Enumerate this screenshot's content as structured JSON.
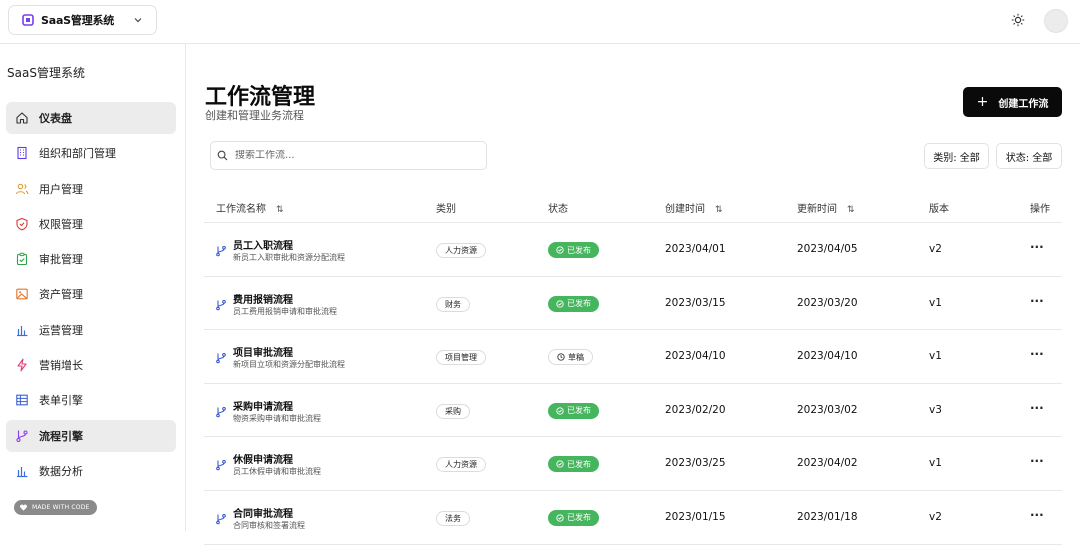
{
  "header": {
    "app_name": "SaaS管理系统",
    "theme_icon": "sun-icon",
    "avatar_icon": "user-avatar"
  },
  "sidebar": {
    "brand": "SaaS管理系统",
    "items": [
      {
        "label": "仪表盘",
        "icon": "home-icon",
        "active": true
      },
      {
        "label": "组织和部门管理",
        "icon": "building-icon"
      },
      {
        "label": "用户管理",
        "icon": "users-icon"
      },
      {
        "label": "权限管理",
        "icon": "shield-icon"
      },
      {
        "label": "审批管理",
        "icon": "clipboard-check-icon"
      },
      {
        "label": "资产管理",
        "icon": "image-icon"
      },
      {
        "label": "运营管理",
        "icon": "bar-chart-icon"
      },
      {
        "label": "营销增长",
        "icon": "zap-icon"
      },
      {
        "label": "表单引擎",
        "icon": "table-icon"
      },
      {
        "label": "流程引擎",
        "icon": "git-branch-icon",
        "active": true
      },
      {
        "label": "数据分析",
        "icon": "bar-chart-icon"
      }
    ],
    "badge": "MADE WITH CODE"
  },
  "main": {
    "title": "工作流管理",
    "subtitle": "创建和管理业务流程",
    "create_button": "创建工作流",
    "search_placeholder": "搜索工作流...",
    "filter_category": "类别: 全部",
    "filter_status": "状态: 全部",
    "columns": {
      "name": "工作流名称",
      "category": "类别",
      "status": "状态",
      "created": "创建时间",
      "updated": "更新时间",
      "version": "版本",
      "actions": "操作"
    },
    "rows": [
      {
        "name": "员工入职流程",
        "desc": "新员工入职审批和资源分配流程",
        "category": "人力资源",
        "status": "已发布",
        "status_type": "published",
        "created": "2023/04/01",
        "updated": "2023/04/05",
        "version": "v2",
        "actions": "···"
      },
      {
        "name": "费用报销流程",
        "desc": "员工费用报销申请和审批流程",
        "category": "财务",
        "status": "已发布",
        "status_type": "published",
        "created": "2023/03/15",
        "updated": "2023/03/20",
        "version": "v1",
        "actions": "···"
      },
      {
        "name": "项目审批流程",
        "desc": "新项目立项和资源分配审批流程",
        "category": "项目管理",
        "status": "草稿",
        "status_type": "draft",
        "created": "2023/04/10",
        "updated": "2023/04/10",
        "version": "v1",
        "actions": "···"
      },
      {
        "name": "采购申请流程",
        "desc": "物资采购申请和审批流程",
        "category": "采购",
        "status": "已发布",
        "status_type": "published",
        "created": "2023/02/20",
        "updated": "2023/03/02",
        "version": "v3",
        "actions": "···"
      },
      {
        "name": "休假申请流程",
        "desc": "员工休假申请和审批流程",
        "category": "人力资源",
        "status": "已发布",
        "status_type": "published",
        "created": "2023/03/25",
        "updated": "2023/04/02",
        "version": "v1",
        "actions": "···"
      },
      {
        "name": "合同审批流程",
        "desc": "合同审核和签署流程",
        "category": "法务",
        "status": "已发布",
        "status_type": "published",
        "created": "2023/01/15",
        "updated": "2023/01/18",
        "version": "v2",
        "actions": "···"
      }
    ]
  },
  "colors": {
    "published": "#45b55e",
    "primary_button": "#0a0a0a",
    "active_nav": "#ececec"
  }
}
